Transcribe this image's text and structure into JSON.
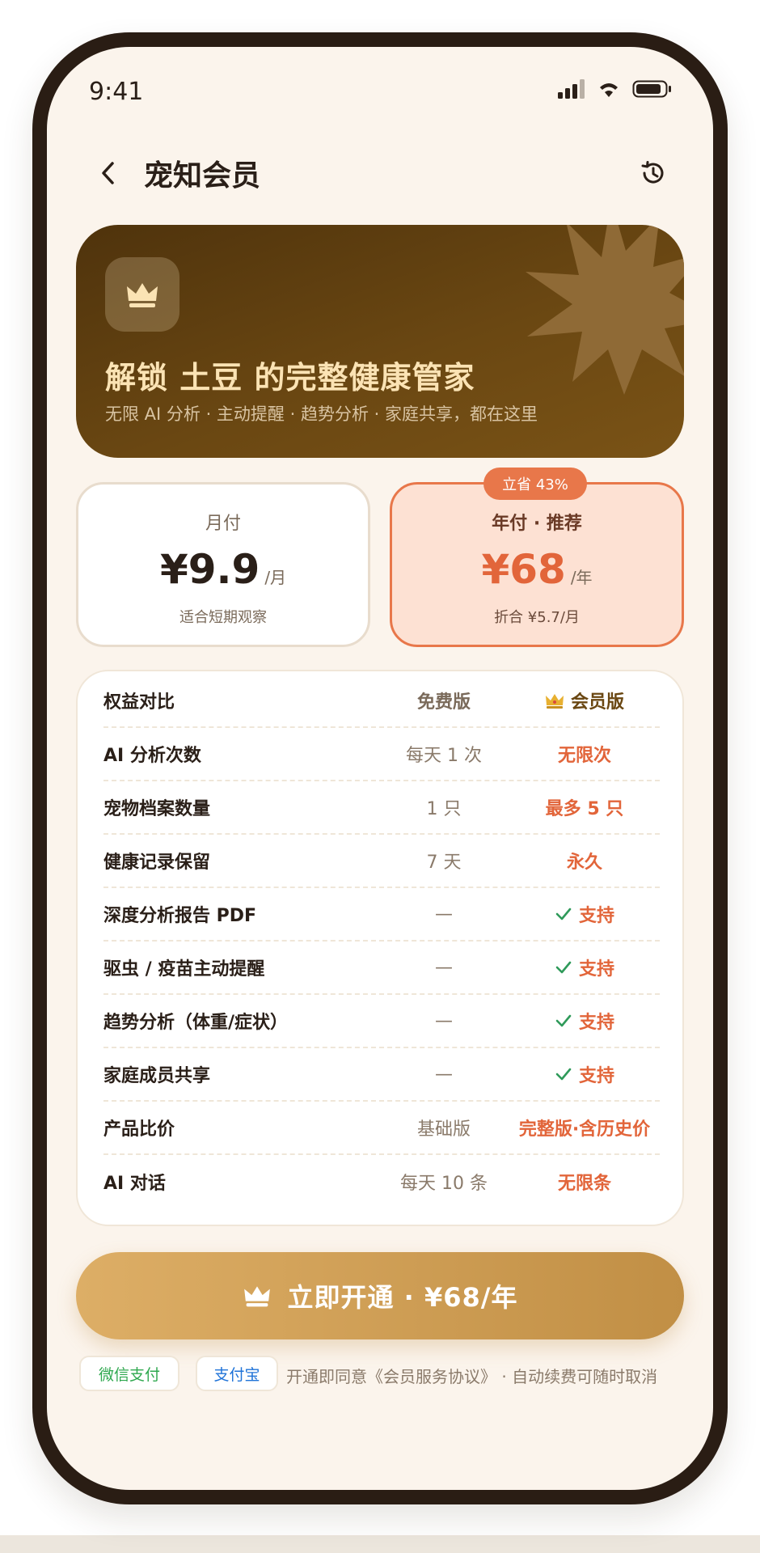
{
  "status_bar": {
    "time": "9:41"
  },
  "nav": {
    "title": "宠知会员",
    "back_icon": "chevron-left-icon",
    "history_icon": "history-icon"
  },
  "hero": {
    "title": "解锁 土豆 的完整健康管家",
    "subtitle": "无限 AI 分析 · 主动提醒 · 趋势分析 · 家庭共享，都在这里"
  },
  "plans": {
    "monthly": {
      "name": "月付",
      "price": "¥9.9",
      "unit": "/月",
      "note": "适合短期观察"
    },
    "yearly": {
      "name": "年付 · 推荐",
      "price": "¥68",
      "unit": "/年",
      "note": "折合 ¥5.7/月",
      "badge": "立省 43%"
    }
  },
  "table": {
    "header": {
      "feature": "权益对比",
      "free": "免费版",
      "vip": "会员版"
    },
    "rows": [
      {
        "feature": "AI 分析次数",
        "free": "每天 1 次",
        "vip": "无限次",
        "check": false
      },
      {
        "feature": "宠物档案数量",
        "free": "1 只",
        "vip": "最多 5 只",
        "check": false
      },
      {
        "feature": "健康记录保留",
        "free": "7 天",
        "vip": "永久",
        "check": false
      },
      {
        "feature": "深度分析报告 PDF",
        "free": "—",
        "vip": "支持",
        "check": true
      },
      {
        "feature": "驱虫 / 疫苗主动提醒",
        "free": "—",
        "vip": "支持",
        "check": true
      },
      {
        "feature": "趋势分析（体重/症状）",
        "free": "—",
        "vip": "支持",
        "check": true
      },
      {
        "feature": "家庭成员共享",
        "free": "—",
        "vip": "支持",
        "check": true
      },
      {
        "feature": "产品比价",
        "free": "基础版",
        "vip": "完整版·含历史价",
        "check": false
      },
      {
        "feature": "AI 对话",
        "free": "每天 10 条",
        "vip": "无限条",
        "check": false
      }
    ]
  },
  "cta": {
    "label": "立即开通 · ¥68/年"
  },
  "footer": {
    "wechat": "微信支付",
    "alipay": "支付宝",
    "agreement": "开通即同意《会员服务协议》 · 自动续费可随时取消"
  },
  "colors": {
    "accent": "#e2653a",
    "brand_gold": "#c18f45",
    "hero_brown": "#5c3d0f"
  }
}
